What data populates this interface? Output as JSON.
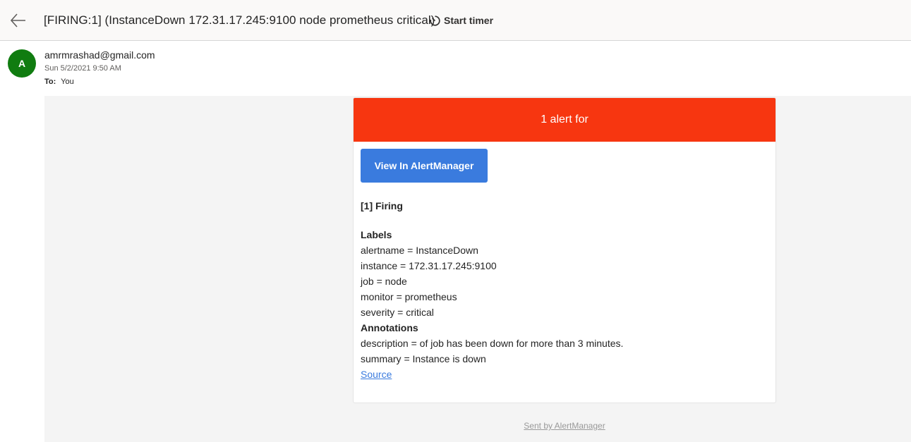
{
  "header": {
    "subject": "[FIRING:1] (InstanceDown 172.31.17.245:9100 node prometheus critical)",
    "start_timer_label": "Start timer",
    "back_icon": "arrow-left-icon",
    "timer_icon": "timer-icon"
  },
  "sender": {
    "avatar_initial": "A",
    "email": "amrmrashad@gmail.com",
    "date": "Sun 5/2/2021 9:50 AM",
    "to_label": "To:",
    "to_value": "You"
  },
  "alert": {
    "header_text": "1 alert for",
    "button_label": "View In AlertManager",
    "firing_title": "[1] Firing",
    "labels_title": "Labels",
    "labels": [
      "alertname = InstanceDown",
      "instance = 172.31.17.245:9100",
      "job = node",
      "monitor = prometheus",
      "severity = critical"
    ],
    "annotations_title": "Annotations",
    "annotations": [
      "description = of job has been down for more than 3 minutes.",
      "summary = Instance is down"
    ],
    "source_link": "Source"
  },
  "footer": {
    "sent_by": "Sent by AlertManager"
  },
  "colors": {
    "alert_header": "#f73610",
    "button": "#3a7bde",
    "avatar": "#107c10"
  }
}
